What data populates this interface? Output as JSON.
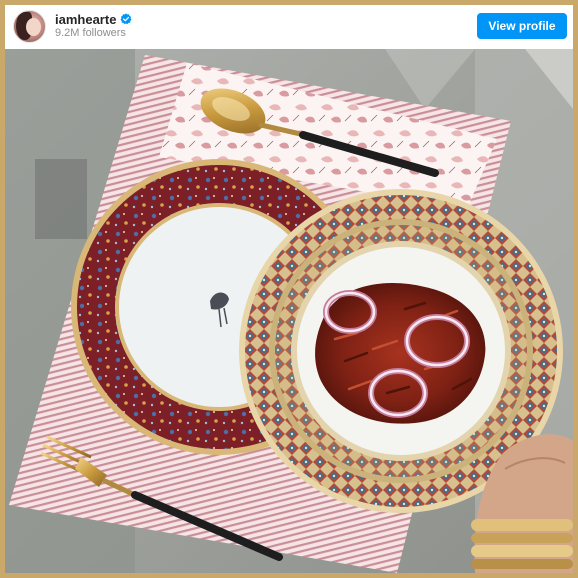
{
  "post": {
    "username": "iamhearte",
    "followers": "9.2M followers",
    "verified": true,
    "view_profile_label": "View profile"
  },
  "icons": {
    "verified": "verified-badge-icon"
  },
  "colors": {
    "brand_button": "#0095f6",
    "verified_badge": "#0095f6",
    "frame_gold": "#c9a86a"
  }
}
